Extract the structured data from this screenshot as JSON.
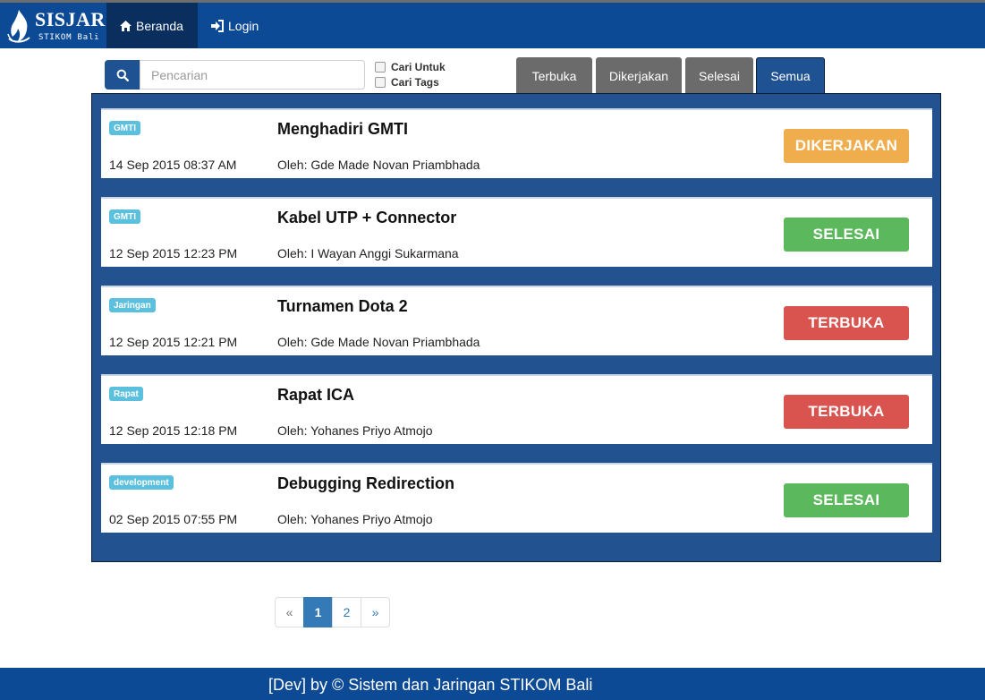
{
  "brand": {
    "name": "SISJAR",
    "sub": "STIKOM Bali"
  },
  "nav": {
    "home": "Beranda",
    "login": "Login"
  },
  "search": {
    "placeholder": "Pencarian",
    "opt1": "Cari Untuk",
    "opt2": "Cari Tags"
  },
  "tabs": [
    "Terbuka",
    "Dikerjakan",
    "Selesai",
    "Semua"
  ],
  "tasks": [
    {
      "tag": "GMTI",
      "date": "14 Sep 2015 08:37 AM",
      "title": "Menghadiri GMTI",
      "author": "Oleh: Gde Made Novan Priambhada",
      "status": "DIKERJAKAN"
    },
    {
      "tag": "GMTI",
      "date": "12 Sep 2015 12:23 PM",
      "title": "Kabel UTP + Connector",
      "author": "Oleh: I Wayan Anggi Sukarmana",
      "status": "SELESAI"
    },
    {
      "tag": "Jaringan",
      "date": "12 Sep 2015 12:21 PM",
      "title": "Turnamen Dota 2",
      "author": "Oleh: Gde Made Novan Priambhada",
      "status": "TERBUKA"
    },
    {
      "tag": "Rapat",
      "date": "12 Sep 2015 12:18 PM",
      "title": "Rapat ICA",
      "author": "Oleh: Yohanes Priyo Atmojo",
      "status": "TERBUKA"
    },
    {
      "tag": "development",
      "date": "02 Sep 2015 07:55 PM",
      "title": "Debugging Redirection",
      "author": "Oleh: Yohanes Priyo Atmojo",
      "status": "SELESAI"
    }
  ],
  "pagination": [
    "«",
    "1",
    "2",
    "»"
  ],
  "footer": "[Dev] by © Sistem dan Jaringan STIKOM Bali",
  "colors": {
    "navbar": "#0d4a96",
    "panel": "#22528f",
    "dikerjakan": "#f0ad4e",
    "selesai": "#5cb85c",
    "terbuka": "#d9534f",
    "tag": "#5bc0de"
  }
}
